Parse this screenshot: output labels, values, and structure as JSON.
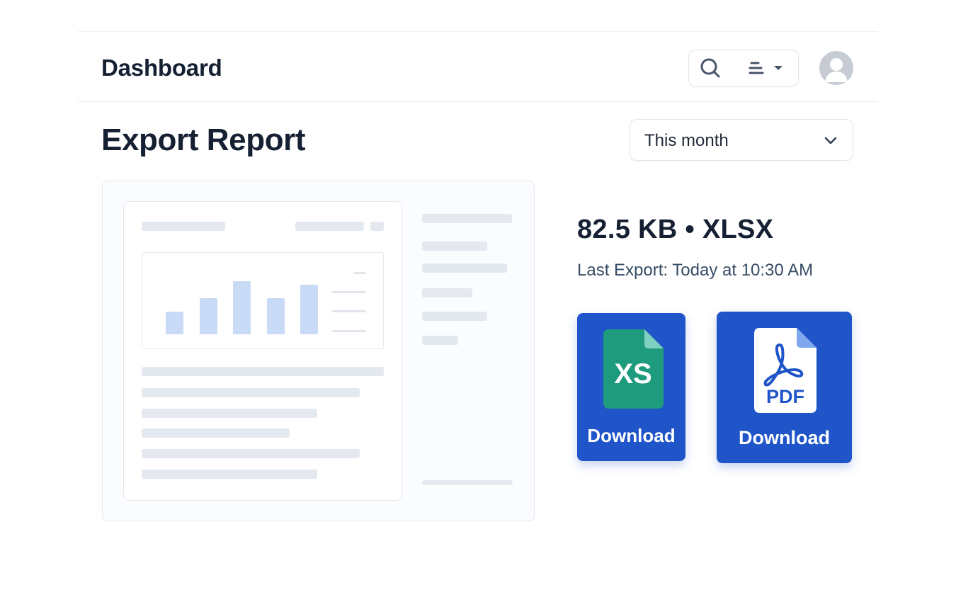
{
  "header": {
    "title": "Dashboard",
    "icons": {
      "search": "search-icon",
      "menu": "sort-lines-icon",
      "dropdown": "caret-down-icon",
      "avatar": "user-avatar-icon"
    }
  },
  "page": {
    "title": "Export Report",
    "period_select": {
      "value": "This month",
      "icon": "chevron-down-icon"
    }
  },
  "file": {
    "info": "82.5 KB • XLSX",
    "last_export": "Last Export: Today at 10:30 AM"
  },
  "downloads": [
    {
      "format_badge": "XS",
      "label": "Download",
      "icon": "excel-file-icon"
    },
    {
      "format_badge": "PDF",
      "label": "Download",
      "icon": "pdf-file-icon"
    }
  ],
  "preview": {
    "chart_bars": [
      0.38,
      0.62,
      0.9,
      0.62,
      0.84
    ]
  },
  "colors": {
    "accent": "#1f55c9",
    "excel": "#1e9a7c",
    "text": "#162033",
    "skeleton": "#e4e8ef",
    "bar": "#c8daf5"
  }
}
